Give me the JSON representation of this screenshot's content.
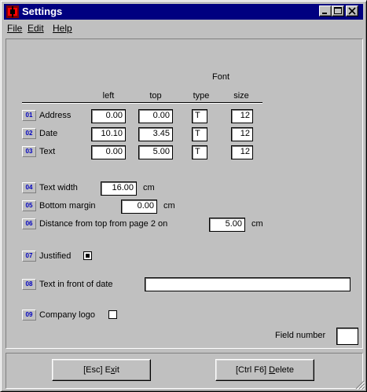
{
  "window": {
    "title": "Settings",
    "minimize_label": "minimize",
    "maximize_label": "maximize",
    "close_label": "close"
  },
  "menu": {
    "file": "File",
    "edit": "Edit",
    "help": "Help"
  },
  "table": {
    "group_header": "Font",
    "columns": [
      "left",
      "top",
      "type",
      "size"
    ],
    "rows": [
      {
        "num": "01",
        "label": "Address",
        "left": "0.00",
        "top": "0.00",
        "type": "T",
        "size": "12"
      },
      {
        "num": "02",
        "label": "Date",
        "left": "10.10",
        "top": "3.45",
        "type": "T",
        "size": "12"
      },
      {
        "num": "03",
        "label": "Text",
        "left": "0.00",
        "top": "5.00",
        "type": "T",
        "size": "12"
      }
    ]
  },
  "fields": {
    "text_width": {
      "num": "04",
      "label": "Text width",
      "value": "16.00",
      "unit": "cm"
    },
    "bottom_margin": {
      "num": "05",
      "label": "Bottom margin",
      "value": "0.00",
      "unit": "cm"
    },
    "distance_top": {
      "num": "06",
      "label": "Distance from top from page 2 on",
      "value": "5.00",
      "unit": "cm"
    },
    "justified": {
      "num": "07",
      "label": "Justified",
      "checked": true
    },
    "text_before_date": {
      "num": "08",
      "label": "Text in front of date",
      "value": ""
    },
    "company_logo": {
      "num": "09",
      "label": "Company logo",
      "checked": false
    },
    "field_number": {
      "label": "Field number",
      "value": ""
    }
  },
  "buttons": {
    "exit_prefix": "[Esc] E",
    "exit_accel": "x",
    "exit_suffix": "it",
    "delete_prefix": "[Ctrl F6] ",
    "delete_accel": "D",
    "delete_suffix": "elete"
  },
  "colors": {
    "titlebar": "#000080",
    "face": "#c0c0c0",
    "number_text": "#0000c0"
  }
}
